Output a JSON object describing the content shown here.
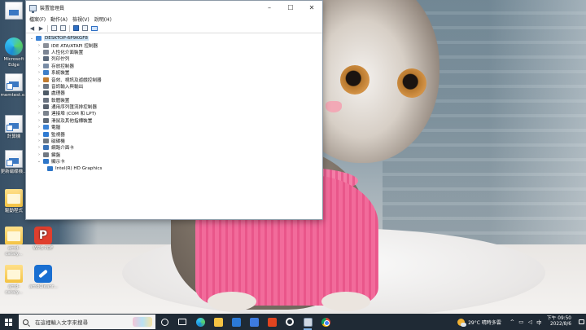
{
  "window": {
    "title": "裝置管理員",
    "menu": [
      "檔案(F)",
      "動作(A)",
      "檢視(V)",
      "說明(H)"
    ],
    "controls": {
      "minimize": "–",
      "maximize": "☐",
      "close": "✕"
    },
    "toolbar": {
      "back": "◀",
      "forward": "▶"
    }
  },
  "tree": {
    "root": {
      "label": "DESKTOP-6P9KGF8",
      "expander": "⌄"
    },
    "collapsed_expander": "›",
    "expanded_expander": "⌄",
    "categories": [
      {
        "label": "IDE ATA/ATAPI 控制器",
        "color": "#8a8f98"
      },
      {
        "label": "人性化介面裝置",
        "color": "#7c8594"
      },
      {
        "label": "列印佇列",
        "color": "#5d6b7d"
      },
      {
        "label": "存放控制器",
        "color": "#7a8da6"
      },
      {
        "label": "系統裝置",
        "color": "#3f7fc9"
      },
      {
        "label": "音效、視訊及遊戲控制器",
        "color": "#c27c30"
      },
      {
        "label": "音訊輸入與輸出",
        "color": "#6d7785"
      },
      {
        "label": "處理器",
        "color": "#4e5a66"
      },
      {
        "label": "軟體裝置",
        "color": "#6a7380"
      },
      {
        "label": "通用序列匯流排控制器",
        "color": "#59626e"
      },
      {
        "label": "連接埠 (COM 和 LPT)",
        "color": "#7b838d"
      },
      {
        "label": "滑鼠及其他指標裝置",
        "color": "#606a76"
      },
      {
        "label": "電腦",
        "color": "#3d84d6"
      },
      {
        "label": "監視器",
        "color": "#2f7bd2"
      },
      {
        "label": "磁碟機",
        "color": "#6f7780"
      },
      {
        "label": "網路介面卡",
        "color": "#3a73b8"
      },
      {
        "label": "鍵盤",
        "color": "#717983"
      },
      {
        "label": "顯示卡",
        "color": "#2e76c8"
      }
    ],
    "display_child": {
      "label": "Intel(R) HD Graphics",
      "color": "#2e76c8"
    }
  },
  "desktop_icons": [
    {
      "label": "",
      "kind": "g-file"
    },
    {
      "label": "Microsoft Edge",
      "kind": "g-edge"
    },
    {
      "label": "memtest.ex",
      "kind": "g-file g-shortcut"
    },
    {
      "label": "計算機",
      "kind": "g-file g-shortcut"
    },
    {
      "label": "更新磁碟機...",
      "kind": "g-file g-shortcut"
    },
    {
      "label": "驅動程式",
      "kind": "g-folder"
    },
    {
      "label": "amd-cataly...",
      "kind": "g-folder"
    },
    {
      "label": "WPS PDF",
      "kind": "g-wps",
      "glyph": "P"
    },
    {
      "label": "amd-cataly...",
      "kind": "g-folder"
    },
    {
      "label": "amdCleanr...",
      "kind": "g-tool"
    }
  ],
  "taskbar": {
    "search_placeholder": "在這裡輸入文字來搜尋",
    "weather": "29°C  晴時多雲",
    "tray_up": "^",
    "ime": "中",
    "time": "下午 09:50",
    "date": "2022/8/6"
  }
}
